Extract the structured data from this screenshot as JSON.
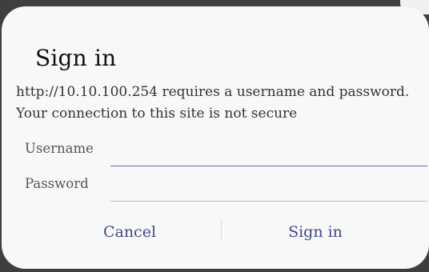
{
  "dialog": {
    "title": "Sign in",
    "message": "http://10.10.100.254 requires a username and password. Your connection to this site is not secure",
    "username_label": "Username",
    "username_value": "",
    "password_label": "Password",
    "password_value": "",
    "cancel_label": "Cancel",
    "signin_label": "Sign in"
  },
  "colors": {
    "backdrop": "#3f3f3f",
    "dialog_bg": "#f8f8f8",
    "accent": "#3b4a8c",
    "focused_underline": "#5a6aa8"
  }
}
